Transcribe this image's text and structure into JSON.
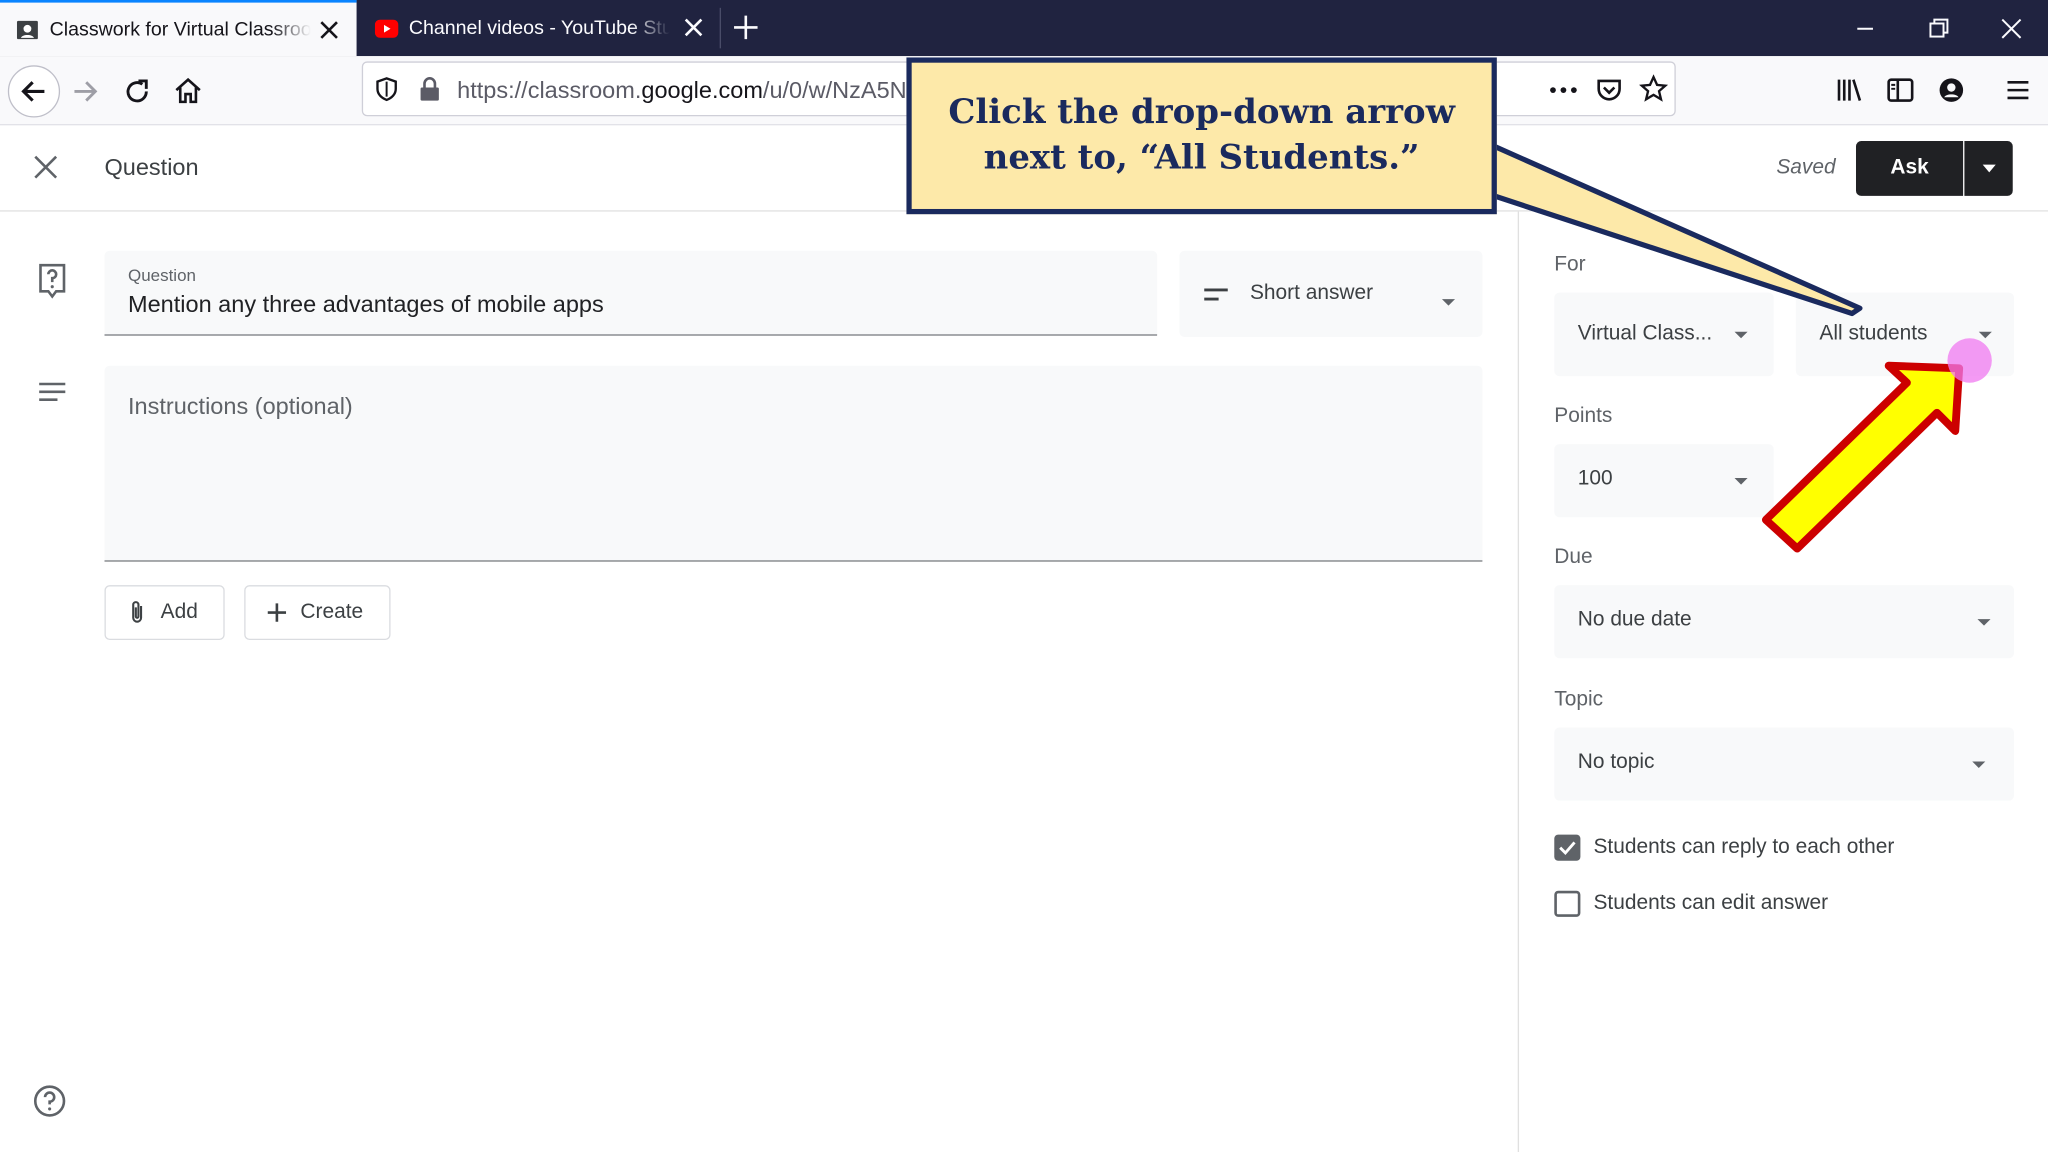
{
  "browser": {
    "tabs": [
      {
        "title": "Classwork for Virtual Classroom",
        "active": true
      },
      {
        "title": "Channel videos - YouTube Studio",
        "active": false
      }
    ],
    "url_prefix": "https://classroom.",
    "url_domain": "google.com",
    "url_suffix": "/u/0/w/NzA5ND"
  },
  "header": {
    "title": "Question",
    "saved_text": "Saved",
    "ask_label": "Ask"
  },
  "form": {
    "question_label": "Question",
    "question_value": "Mention any three advantages of mobile apps",
    "answer_type": "Short answer",
    "instructions_placeholder": "Instructions (optional)",
    "add_label": "Add",
    "create_label": "Create"
  },
  "panel": {
    "for_label": "For",
    "class_value": "Virtual Class...",
    "students_value": "All students",
    "points_label": "Points",
    "points_value": "100",
    "due_label": "Due",
    "due_value": "No due date",
    "topic_label": "Topic",
    "topic_value": "No topic",
    "checkboxes": [
      {
        "label": "Students can reply to each other",
        "checked": true
      },
      {
        "label": "Students can edit answer",
        "checked": false
      }
    ]
  },
  "annotation": {
    "line1": "Click the drop-down arrow",
    "line2": "next to, “All Students.”",
    "callout_bg": "#fde9a9",
    "callout_border": "#1a2a5e",
    "arrow_fill": "#ffff00",
    "arrow_outline": "#cc0000"
  },
  "colors": {
    "tabbar_bg": "#202340",
    "ask_button_bg": "#202124",
    "field_bg": "#f8f9fa"
  }
}
